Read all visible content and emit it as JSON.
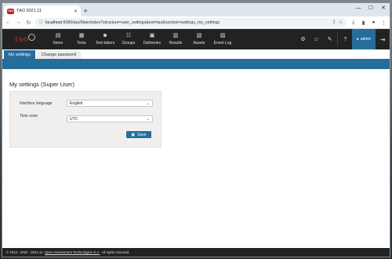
{
  "browser": {
    "tab_title": "TAO 2021.11",
    "favicon_text": "TAO",
    "tab_close": "✕",
    "new_tab": "+",
    "window_controls": {
      "minimize": "—",
      "maximize": "☐",
      "close": "✕"
    },
    "url_host": "localhost",
    "url_rest": ":9080/tao/Main/index?structure=user_settings&ext=tao&section=settings_my_settings"
  },
  "tao": {
    "logo_text": "TAO",
    "nav": [
      {
        "label": "Items",
        "icon": "items-icon",
        "glyph": "▤"
      },
      {
        "label": "Tests",
        "icon": "tests-icon",
        "glyph": "▦"
      },
      {
        "label": "Test-takers",
        "icon": "test-takers-icon",
        "glyph": "☻"
      },
      {
        "label": "Groups",
        "icon": "groups-icon",
        "glyph": "☷"
      },
      {
        "label": "Deliveries",
        "icon": "deliveries-icon",
        "glyph": "▣"
      },
      {
        "label": "Results",
        "icon": "results-icon",
        "glyph": "▥"
      },
      {
        "label": "Assets",
        "icon": "assets-icon",
        "glyph": "▧"
      },
      {
        "label": "Event Log",
        "icon": "event-log-icon",
        "glyph": "▨"
      }
    ],
    "user_label": "admin"
  },
  "section_tabs": [
    "My settings",
    "Change password"
  ],
  "page_title": "My settings (Super User)",
  "form": {
    "interface_language": {
      "label": "Interface language",
      "value": "English"
    },
    "time_zone": {
      "label": "Time zone",
      "value": "UTC"
    },
    "save_label": "Save"
  },
  "footer": {
    "text": "© 2013 - 2022 · 2021.11 · ",
    "link": "Open Assessment Technologies S.A.",
    "rights": " · All rights reserved."
  },
  "colors": {
    "accent": "#266d9c",
    "header_bg": "#222222",
    "logo_red": "#c0282d",
    "panel_bg": "#f0efed"
  }
}
